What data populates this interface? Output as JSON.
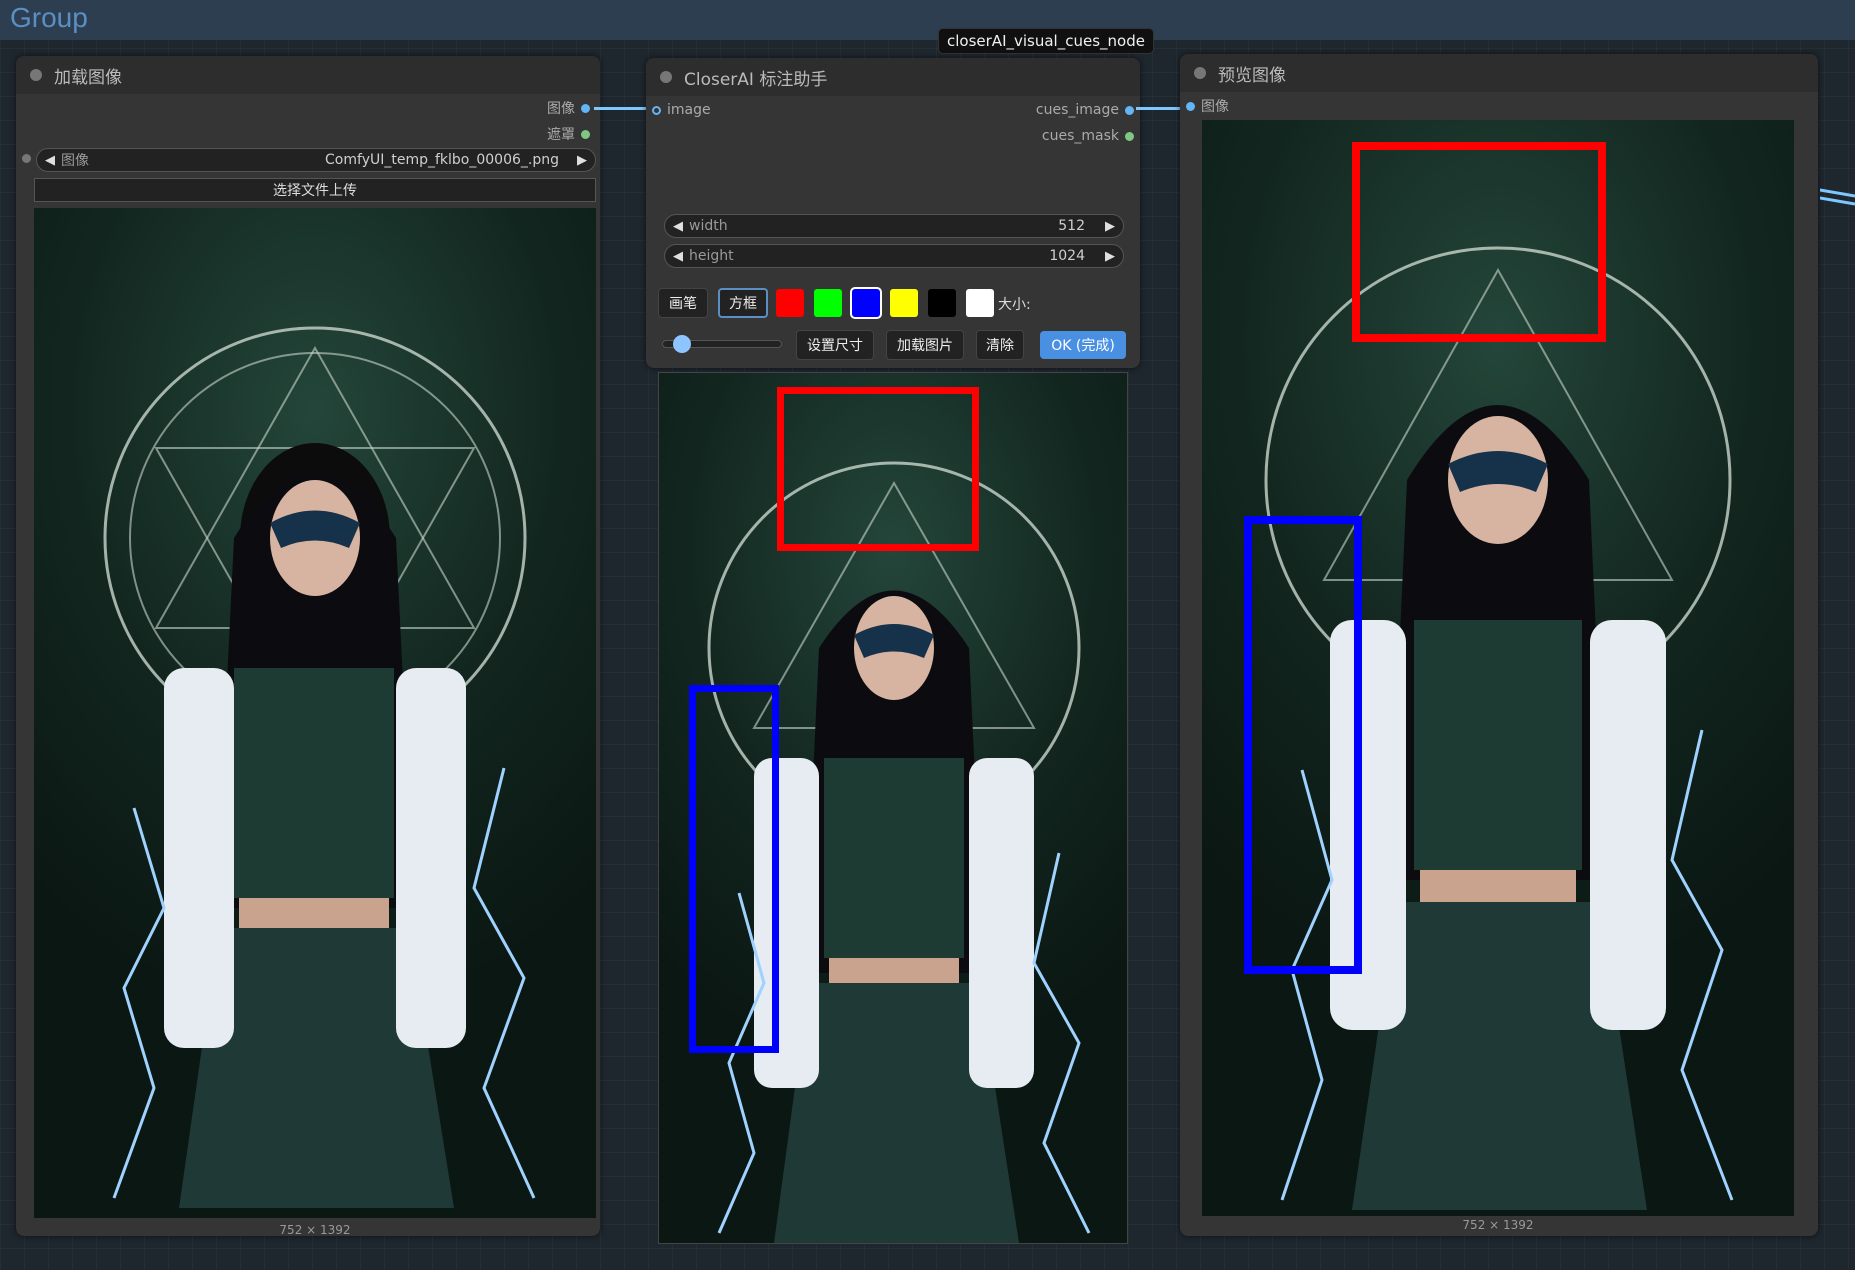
{
  "group": {
    "title": "Group"
  },
  "badge": {
    "text": "closerAI_visual_cues_node"
  },
  "load_node": {
    "title": "加载图像",
    "outputs": [
      {
        "label": "图像",
        "color": "#64b5f6"
      },
      {
        "label": "遮罩",
        "color": "#81c784"
      }
    ],
    "image_widget": {
      "label": "图像",
      "value": "ComfyUI_temp_fklbo_00006_.png"
    },
    "upload_button": "选择文件上传",
    "caption": "752 × 1392"
  },
  "cues_node": {
    "title": "CloserAI 标注助手",
    "input": "image",
    "outputs": [
      {
        "label": "cues_image",
        "color": "#64b5f6"
      },
      {
        "label": "cues_mask",
        "color": "#81c784"
      }
    ],
    "width": {
      "label": "width",
      "value": "512"
    },
    "height": {
      "label": "height",
      "value": "1024"
    },
    "tools": {
      "brush": "画笔",
      "box": "方框"
    },
    "colors": [
      "#ff0000",
      "#00ff00",
      "#0000ff",
      "#ffff00",
      "#000000",
      "#ffffff"
    ],
    "active_color": 2,
    "size_label": "大小:",
    "brush_size": 0.1,
    "buttons": {
      "set_size": "设置尺寸",
      "load_image": "加载图片",
      "clear": "清除",
      "ok": "OK (完成)"
    }
  },
  "preview_node": {
    "title": "预览图像",
    "input": "图像",
    "caption": "752 × 1392"
  },
  "marks": {
    "red": "#ff0000",
    "blue": "#0000ff"
  }
}
